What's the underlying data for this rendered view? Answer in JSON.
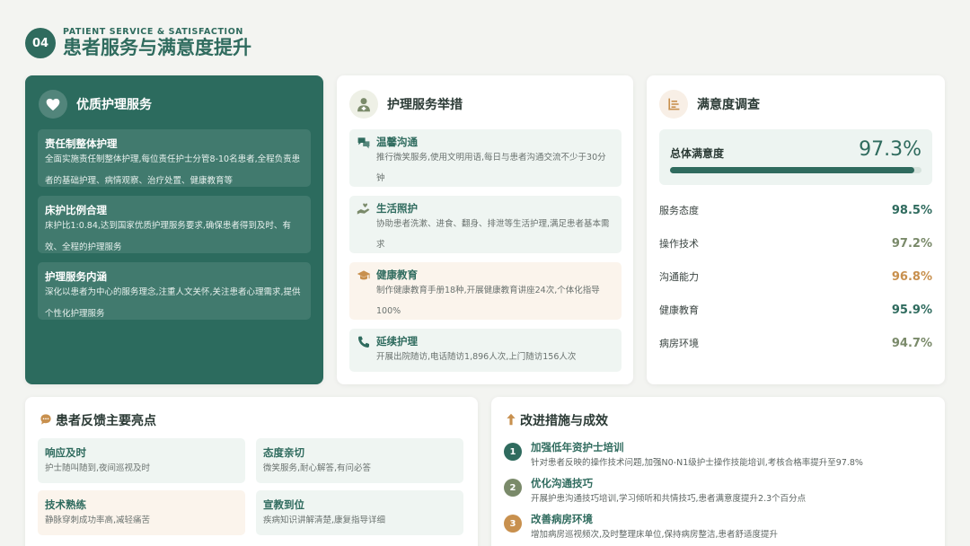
{
  "header": {
    "number": "04",
    "eyebrow": "PATIENT SERVICE & SATISFACTION",
    "title": "患者服务与满意度提升"
  },
  "quality_care": {
    "title": "优质护理服务",
    "items": [
      {
        "title": "责任制整体护理",
        "desc": "全面实施责任制整体护理,每位责任护士分管8-10名患者,全程负责患者的基础护理、病情观察、治疗处置、健康教育等"
      },
      {
        "title": "床护比例合理",
        "desc": "床护比1:0.84,达到国家优质护理服务要求,确保患者得到及时、有效、全程的护理服务"
      },
      {
        "title": "护理服务内涵",
        "desc": "深化以患者为中心的服务理念,注重人文关怀,关注患者心理需求,提供个性化护理服务"
      }
    ]
  },
  "measures": {
    "title": "护理服务举措",
    "items": [
      {
        "icon": "chat-bubbles-icon",
        "title": "温馨沟通",
        "desc": "推行微笑服务,使用文明用语,每日与患者沟通交流不少于30分钟"
      },
      {
        "icon": "care-hand-icon",
        "title": "生活照护",
        "desc": "协助患者洗漱、进食、翻身、排泄等生活护理,满足患者基本需求"
      },
      {
        "icon": "graduation-cap-icon",
        "title": "健康教育",
        "desc": "制作健康教育手册18种,开展健康教育讲座24次,个体化指导100%"
      },
      {
        "icon": "phone-icon",
        "title": "延续护理",
        "desc": "开展出院随访,电话随访1,896人次,上门随访156人次"
      }
    ]
  },
  "survey": {
    "title": "满意度调查",
    "overall_label": "总体满意度",
    "overall_value": "97.3%",
    "overall_fraction": 0.973,
    "metrics": [
      {
        "label": "服务态度",
        "value": "98.5%",
        "color": "#2f6b5e"
      },
      {
        "label": "操作技术",
        "value": "97.2%",
        "color": "#7a8a6a"
      },
      {
        "label": "沟通能力",
        "value": "96.8%",
        "color": "#c8904e"
      },
      {
        "label": "健康教育",
        "value": "95.9%",
        "color": "#2f6b5e"
      },
      {
        "label": "病房环境",
        "value": "94.7%",
        "color": "#7a8a6a"
      }
    ]
  },
  "feedback": {
    "title": "患者反馈主要亮点",
    "items": [
      {
        "title": "响应及时",
        "desc": "护士随叫随到,夜间巡视及时"
      },
      {
        "title": "态度亲切",
        "desc": "微笑服务,耐心解答,有问必答"
      },
      {
        "title": "技术熟练",
        "desc": "静脉穿刺成功率高,减轻痛苦"
      },
      {
        "title": "宣教到位",
        "desc": "疾病知识讲解清楚,康复指导详细"
      }
    ]
  },
  "improvements": {
    "title": "改进措施与成效",
    "items": [
      {
        "num": "1",
        "color": "#2f6b5e",
        "title": "加强低年资护士培训",
        "desc": "针对患者反映的操作技术问题,加强N0-N1级护士操作技能培训,考核合格率提升至97.8%"
      },
      {
        "num": "2",
        "color": "#7a8a6a",
        "title": "优化沟通技巧",
        "desc": "开展护患沟通技巧培训,学习倾听和共情技巧,患者满意度提升2.3个百分点"
      },
      {
        "num": "3",
        "color": "#c8904e",
        "title": "改善病房环境",
        "desc": "增加病房巡视频次,及时整理床单位,保持病房整洁,患者舒适度提升"
      }
    ]
  }
}
